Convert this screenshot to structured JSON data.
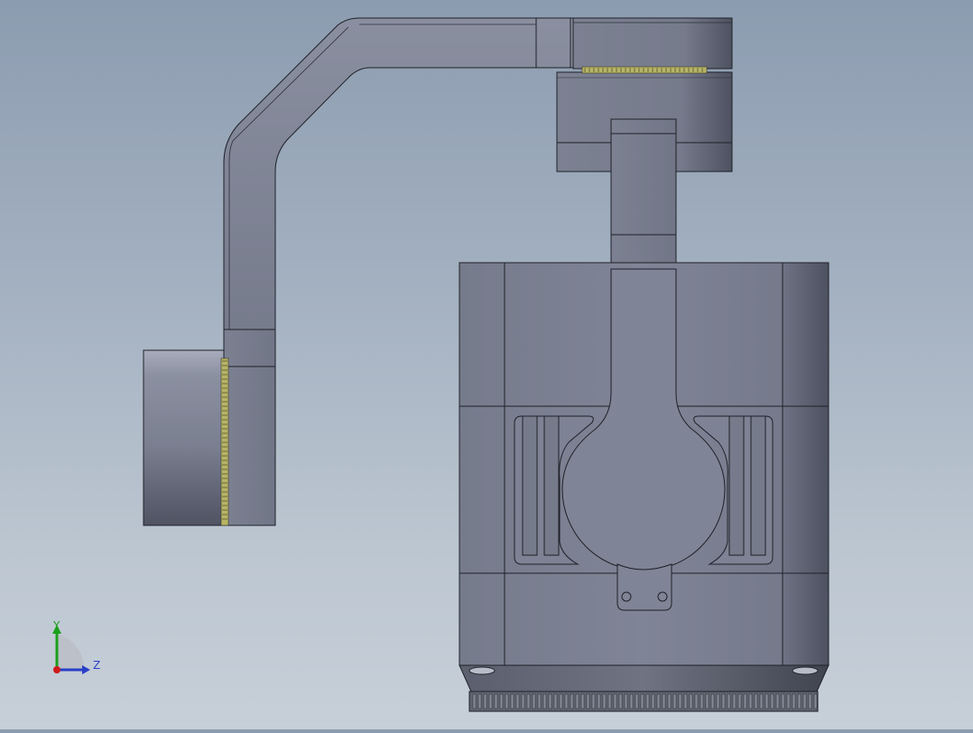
{
  "view": {
    "background_top": "#8c9cb0",
    "background_bottom": "#c7cfd8",
    "part_color": "#7f8597",
    "edge_color": "#1e2128",
    "bearing_color": "#b7b466"
  },
  "triad": {
    "y_label": "Y",
    "z_label": "Z",
    "y_color": "#1aa01a",
    "z_color": "#2a3fc8",
    "x_color": "#d01a1a"
  }
}
